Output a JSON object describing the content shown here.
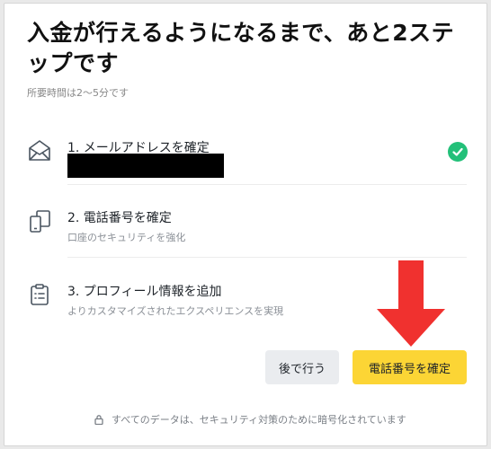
{
  "dialog": {
    "title": "入金が行えるようになるまで、あと2ステップです",
    "subtitle": "所要時間は2～5分です"
  },
  "steps": [
    {
      "title": "1. メールアドレスを確定",
      "icon": "mail-icon",
      "status": "completed"
    },
    {
      "title": "2. 電話番号を確定",
      "description": "口座のセキュリティを強化",
      "icon": "phone-icon"
    },
    {
      "title": "3. プロフィール情報を追加",
      "description": "よりカスタマイズされたエクスペリエンスを実現",
      "icon": "clipboard-icon"
    }
  ],
  "buttons": {
    "later": "後で行う",
    "confirm_phone": "電話番号を確定"
  },
  "footer": {
    "text": "すべてのデータは、セキュリティ対策のために暗号化されています",
    "icon": "lock-icon"
  },
  "colors": {
    "accent": "#fcd535",
    "success": "#23c079",
    "annotation_arrow": "#f0312f"
  }
}
